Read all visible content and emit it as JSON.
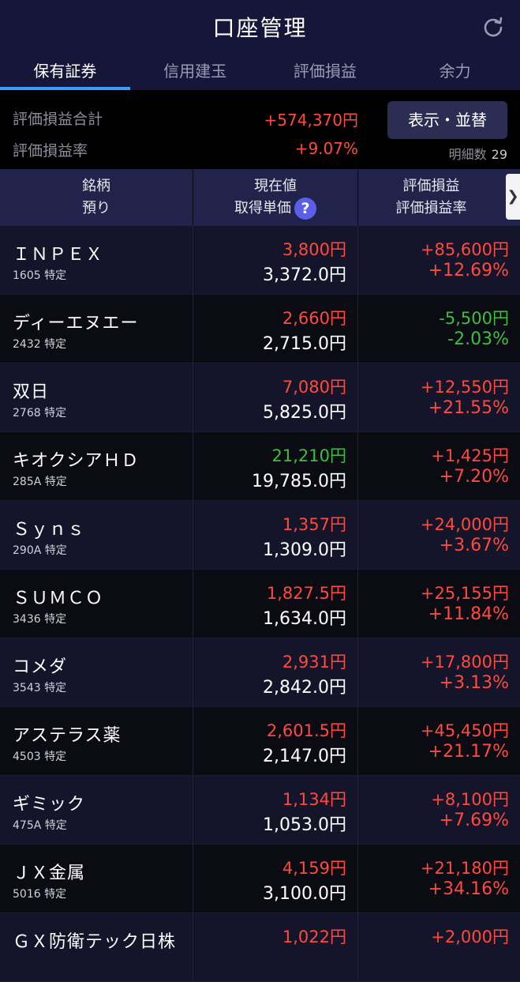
{
  "header": {
    "title": "口座管理"
  },
  "tabs": [
    {
      "label": "保有証券",
      "active": true
    },
    {
      "label": "信用建玉",
      "active": false
    },
    {
      "label": "評価損益",
      "active": false
    },
    {
      "label": "余力",
      "active": false
    }
  ],
  "summary": {
    "total_label": "評価損益合計",
    "total_value": "+574,370円",
    "rate_label": "評価損益率",
    "rate_value": "+9.07%",
    "sort_button": "表示・並替",
    "count_label": "明細数",
    "count_value": "29"
  },
  "table_header": {
    "col1_line1": "銘柄",
    "col1_line2": "預り",
    "col2_line1": "現在値",
    "col2_line2": "取得単価",
    "col3_line1": "評価損益",
    "col3_line2": "評価損益率",
    "help_icon": "?",
    "scroll_icon": "❯"
  },
  "colors": {
    "up": "#ff4a3d",
    "down": "#3dbf3d",
    "tab_accent": "#3d9bff"
  },
  "holdings": [
    {
      "name": "ＩＮＰＥＸ",
      "code": "1605 特定",
      "price": "3,800円",
      "price_dir": "up",
      "cost": "3,372.0円",
      "pl": "+85,600円",
      "plr": "+12.69%",
      "pl_dir": "up"
    },
    {
      "name": "ディーエヌエー",
      "code": "2432 特定",
      "price": "2,660円",
      "price_dir": "up",
      "cost": "2,715.0円",
      "pl": "-5,500円",
      "plr": "-2.03%",
      "pl_dir": "down"
    },
    {
      "name": "双日",
      "code": "2768 特定",
      "price": "7,080円",
      "price_dir": "up",
      "cost": "5,825.0円",
      "pl": "+12,550円",
      "plr": "+21.55%",
      "pl_dir": "up"
    },
    {
      "name": "キオクシアＨＤ",
      "code": "285A 特定",
      "price": "21,210円",
      "price_dir": "down",
      "cost": "19,785.0円",
      "pl": "+1,425円",
      "plr": "+7.20%",
      "pl_dir": "up"
    },
    {
      "name": "Ｓｙｎｓ",
      "code": "290A 特定",
      "price": "1,357円",
      "price_dir": "up",
      "cost": "1,309.0円",
      "pl": "+24,000円",
      "plr": "+3.67%",
      "pl_dir": "up"
    },
    {
      "name": "ＳＵＭＣＯ",
      "code": "3436 特定",
      "price": "1,827.5円",
      "price_dir": "up",
      "cost": "1,634.0円",
      "pl": "+25,155円",
      "plr": "+11.84%",
      "pl_dir": "up"
    },
    {
      "name": "コメダ",
      "code": "3543 特定",
      "price": "2,931円",
      "price_dir": "up",
      "cost": "2,842.0円",
      "pl": "+17,800円",
      "plr": "+3.13%",
      "pl_dir": "up"
    },
    {
      "name": "アステラス薬",
      "code": "4503 特定",
      "price": "2,601.5円",
      "price_dir": "up",
      "cost": "2,147.0円",
      "pl": "+45,450円",
      "plr": "+21.17%",
      "pl_dir": "up"
    },
    {
      "name": "ギミック",
      "code": "475A 特定",
      "price": "1,134円",
      "price_dir": "up",
      "cost": "1,053.0円",
      "pl": "+8,100円",
      "plr": "+7.69%",
      "pl_dir": "up"
    },
    {
      "name": "ＪＸ金属",
      "code": "5016 特定",
      "price": "4,159円",
      "price_dir": "up",
      "cost": "3,100.0円",
      "pl": "+21,180円",
      "plr": "+34.16%",
      "pl_dir": "up"
    },
    {
      "name": "ＧＸ防衛テック日株",
      "code": "",
      "price": "1,022円",
      "price_dir": "up",
      "cost": "",
      "pl": "+2,000円",
      "plr": "",
      "pl_dir": "up"
    }
  ]
}
